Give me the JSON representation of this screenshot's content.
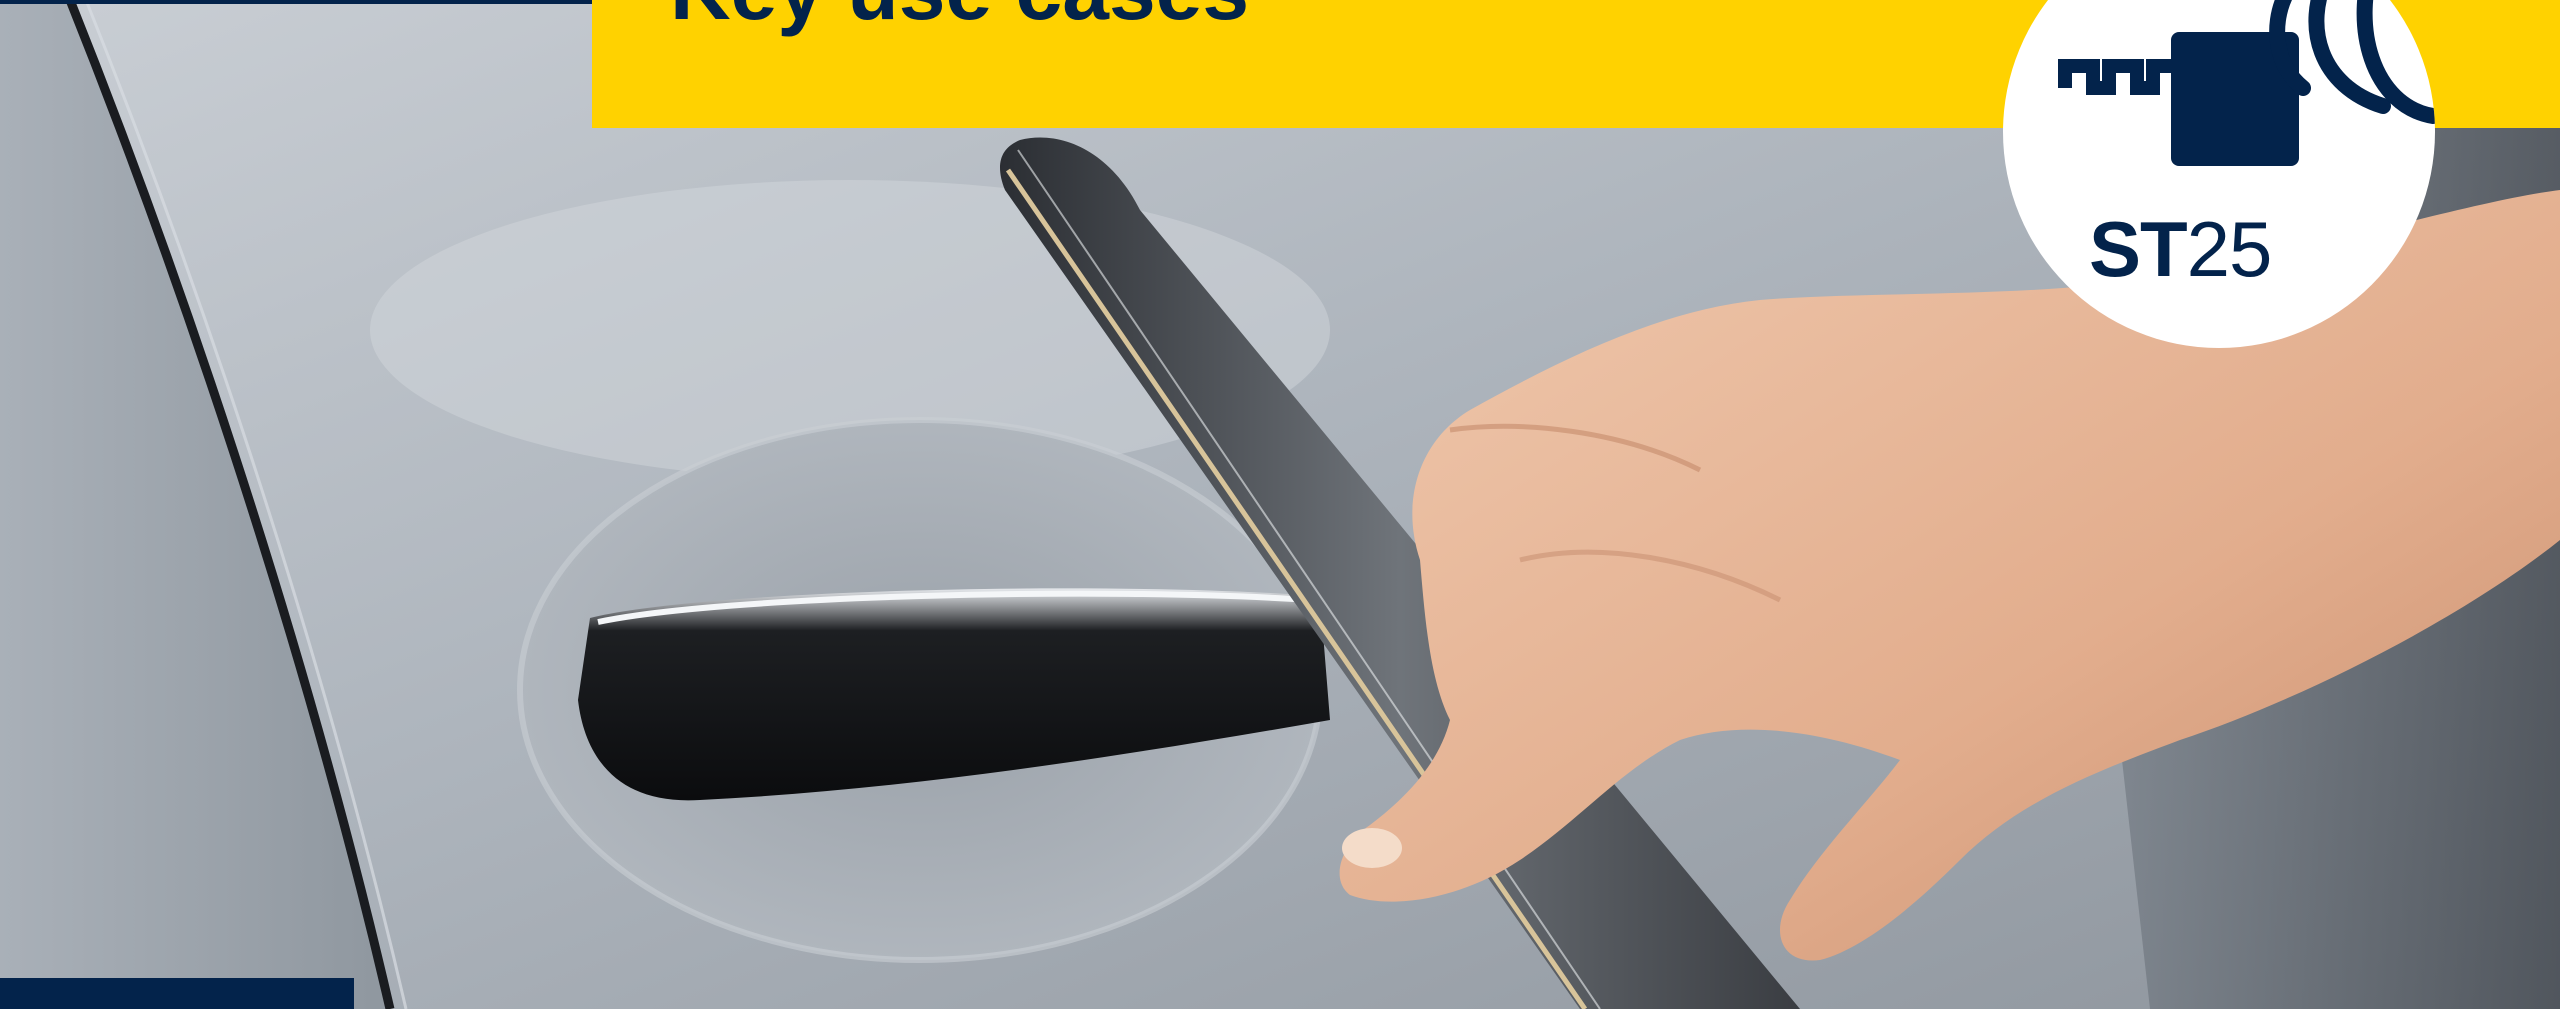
{
  "banner": {
    "title": "Key use cases",
    "background": "#ffd200",
    "text_color": "#03234b"
  },
  "badge": {
    "brand_bold": "ST",
    "brand_light": "25",
    "icon": "nfc-tag-wireless-icon",
    "color": "#03234b"
  },
  "photo": {
    "subject": "car-door-handle-with-smartphone-icon"
  }
}
